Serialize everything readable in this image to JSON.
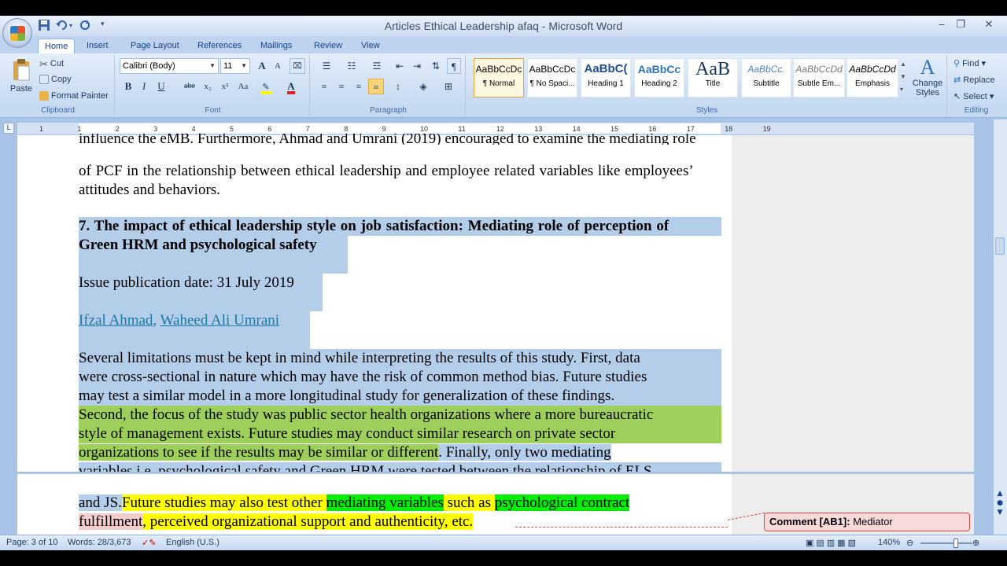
{
  "window": {
    "title": "Articles Ethical Leadership afaq - Microsoft Word",
    "minimize": "‒",
    "restore": "❐",
    "close": "✕"
  },
  "tabs": [
    "Home",
    "Insert",
    "Page Layout",
    "References",
    "Mailings",
    "Review",
    "View"
  ],
  "clipboard": {
    "group_label": "Clipboard",
    "paste": "Paste",
    "cut": "Cut",
    "copy": "Copy",
    "format_painter": "Format Painter"
  },
  "font": {
    "group_label": "Font",
    "font_name": "Calibri (Body)",
    "font_size": "11",
    "bold": "B",
    "italic": "I",
    "underline": "U",
    "strike": "abe",
    "subscript": "x₂",
    "superscript": "x²",
    "change_case": "Aa",
    "grow": "A",
    "shrink": "A"
  },
  "paragraph": {
    "group_label": "Paragraph",
    "show_marks": "¶"
  },
  "styles": {
    "group_label": "Styles",
    "items": [
      {
        "sample": "AaBbCcDc",
        "name": "¶ Normal"
      },
      {
        "sample": "AaBbCcDc",
        "name": "¶ No Spaci..."
      },
      {
        "sample": "AaBbC(",
        "name": "Heading 1"
      },
      {
        "sample": "AaBbCc",
        "name": "Heading 2"
      },
      {
        "sample": "AaB",
        "name": "Title"
      },
      {
        "sample": "AaBbCc.",
        "name": "Subtitle"
      },
      {
        "sample": "AaBbCcDd",
        "name": "Subtle Em..."
      },
      {
        "sample": "AaBbCcDd",
        "name": "Emphasis"
      }
    ],
    "change_styles": "Change Styles"
  },
  "editing": {
    "group_label": "Editing",
    "find": "Find",
    "replace": "Replace",
    "select": "Select"
  },
  "ruler": {
    "corner": "L",
    "ticks": [
      "1",
      "1",
      "2",
      "3",
      "4",
      "5",
      "6",
      "7",
      "8",
      "9",
      "10",
      "11",
      "12",
      "13",
      "14",
      "15",
      "16",
      "17",
      "18",
      "19"
    ]
  },
  "document": {
    "top_line_1": "influence the eMB. Furthermore, Ahmad and Umrani (2019) encouraged to examine the mediating role",
    "top_line_2": "of PCF in the relationship between ethical leadership and employee related variables like employees’",
    "top_line_3": "attitudes and behaviors.",
    "heading_line_1": "7. The impact of ethical leadership style on job satisfaction: Mediating role of perception of",
    "heading_line_2": "Green HRM and psychological safety",
    "pub_date": "Issue publication date: 31 July 2019",
    "author_1": "Ifzal Ahmad",
    "author_sep": ", ",
    "author_2": "Waheed Ali Umrani",
    "para_lines": [
      "Several limitations must be kept in mind while interpreting the results of this study. First, data",
      "were cross-sectional in nature which may have the risk of common method bias. Future studies",
      "may test a similar model in a more longitudinal study for generalization of these findings."
    ],
    "green_lines": [
      "Second, the focus of the study was public sector health organizations where a more bureaucratic",
      "style of management exists. Future studies may conduct similar research on private sector"
    ],
    "green_line_3a": "organizations to see if the results may be similar or different",
    "green_line_3b": ". Finally, only two mediating",
    "para_last": "variables i.e. psychological safety and Green HRM were tested between the relationship of ELS",
    "p2_a": "and JS.",
    "p2_b": "Future studies may also test other ",
    "p2_c": "mediating variables",
    "p2_d": " such as ",
    "p2_e": "psychological contract",
    "p2_f": "fulfillment",
    "p2_g": ", perceived organizational support and authenticity, etc."
  },
  "comment": {
    "label": "Comment [AB1]:",
    "text": "Mediator"
  },
  "status": {
    "page": "Page: 3 of 10",
    "words": "Words: 28/3,673",
    "language": "English (U.S.)",
    "zoom": "140%"
  }
}
